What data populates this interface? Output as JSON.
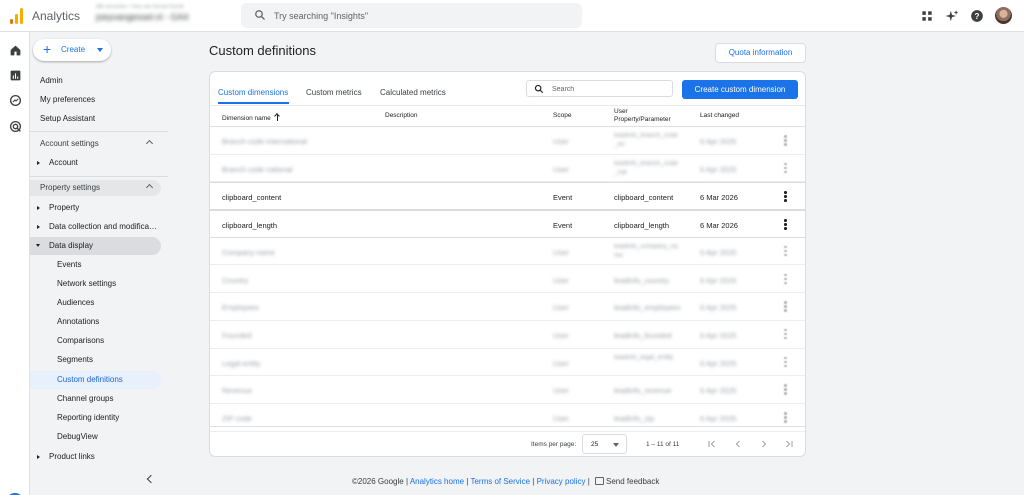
{
  "topbar": {
    "brand": "Analytics",
    "account_line1": "Alle accounts > Joey van Gessel Social",
    "account_line2": "joeyvangessel.nl - GA4",
    "search_placeholder": "Try searching \"Insights\""
  },
  "nav": {
    "create_label": "Create",
    "admin": "Admin",
    "my_preferences": "My preferences",
    "setup_assistant": "Setup Assistant",
    "account_settings": "Account settings",
    "account": "Account",
    "property_settings": "Property settings",
    "property": "Property",
    "data_collection": "Data collection and modifica…",
    "data_display": "Data display",
    "data_display_items": [
      "Events",
      "Network settings",
      "Audiences",
      "Annotations",
      "Comparisons",
      "Segments",
      "Custom definitions",
      "Channel groups",
      "Reporting identity",
      "DebugView"
    ],
    "product_links": "Product links",
    "selected_item": "Custom definitions"
  },
  "main": {
    "title": "Custom definitions",
    "quota_button": "Quota information",
    "tabs": [
      {
        "label": "Custom dimensions",
        "active": true
      },
      {
        "label": "Custom metrics",
        "active": false
      },
      {
        "label": "Calculated metrics",
        "active": false
      }
    ],
    "search_placeholder": "Search",
    "create_button": "Create custom dimension",
    "columns": {
      "name": "Dimension name",
      "description": "Description",
      "scope": "Scope",
      "param_line1": "User",
      "param_line2": "Property/Parameter",
      "last_changed": "Last changed"
    },
    "rows": [
      {
        "name": "Branch code international",
        "scope": "User",
        "param": "leadinfo_branch_code_int",
        "date": "6 Apr 2025",
        "blurred": true
      },
      {
        "name": "Branch code national",
        "scope": "User",
        "param": "leadinfo_branch_code_nat",
        "date": "6 Apr 2025",
        "blurred": true
      },
      {
        "name": "clipboard_content",
        "scope": "Event",
        "param": "clipboard_content",
        "date": "6 Mar 2026",
        "blurred": false
      },
      {
        "name": "clipboard_length",
        "scope": "Event",
        "param": "clipboard_length",
        "date": "6 Mar 2026",
        "blurred": false
      },
      {
        "name": "Company name",
        "scope": "User",
        "param": "leadinfo_company_name",
        "date": "6 Apr 2025",
        "blurred": true
      },
      {
        "name": "Country",
        "scope": "User",
        "param": "leadinfo_country",
        "date": "6 Apr 2025",
        "blurred": true
      },
      {
        "name": "Employees",
        "scope": "User",
        "param": "leadinfo_employees",
        "date": "6 Apr 2025",
        "blurred": true
      },
      {
        "name": "Founded",
        "scope": "User",
        "param": "leadinfo_founded",
        "date": "6 Apr 2025",
        "blurred": true
      },
      {
        "name": "Legal entity",
        "scope": "User",
        "param": "leadinfo_legal_entity",
        "date": "6 Apr 2025",
        "blurred": true
      },
      {
        "name": "Revenue",
        "scope": "User",
        "param": "leadinfo_revenue",
        "date": "6 Apr 2025",
        "blurred": true
      },
      {
        "name": "ZIP code",
        "scope": "User",
        "param": "leadinfo_zip",
        "date": "6 Apr 2025",
        "blurred": true
      }
    ],
    "pagination": {
      "items_per_page_label": "Items per page:",
      "items_per_page": "25",
      "range": "1 – 11 of 11"
    }
  },
  "footer": {
    "copyright": "©2026 Google",
    "analytics_home": "Analytics home",
    "terms": "Terms of Service",
    "privacy": "Privacy policy",
    "feedback": "Send feedback"
  },
  "colors": {
    "accent": "#1a73e8",
    "selected_nav": "#e8f0fe",
    "expanded_nav": "#dadce0"
  }
}
